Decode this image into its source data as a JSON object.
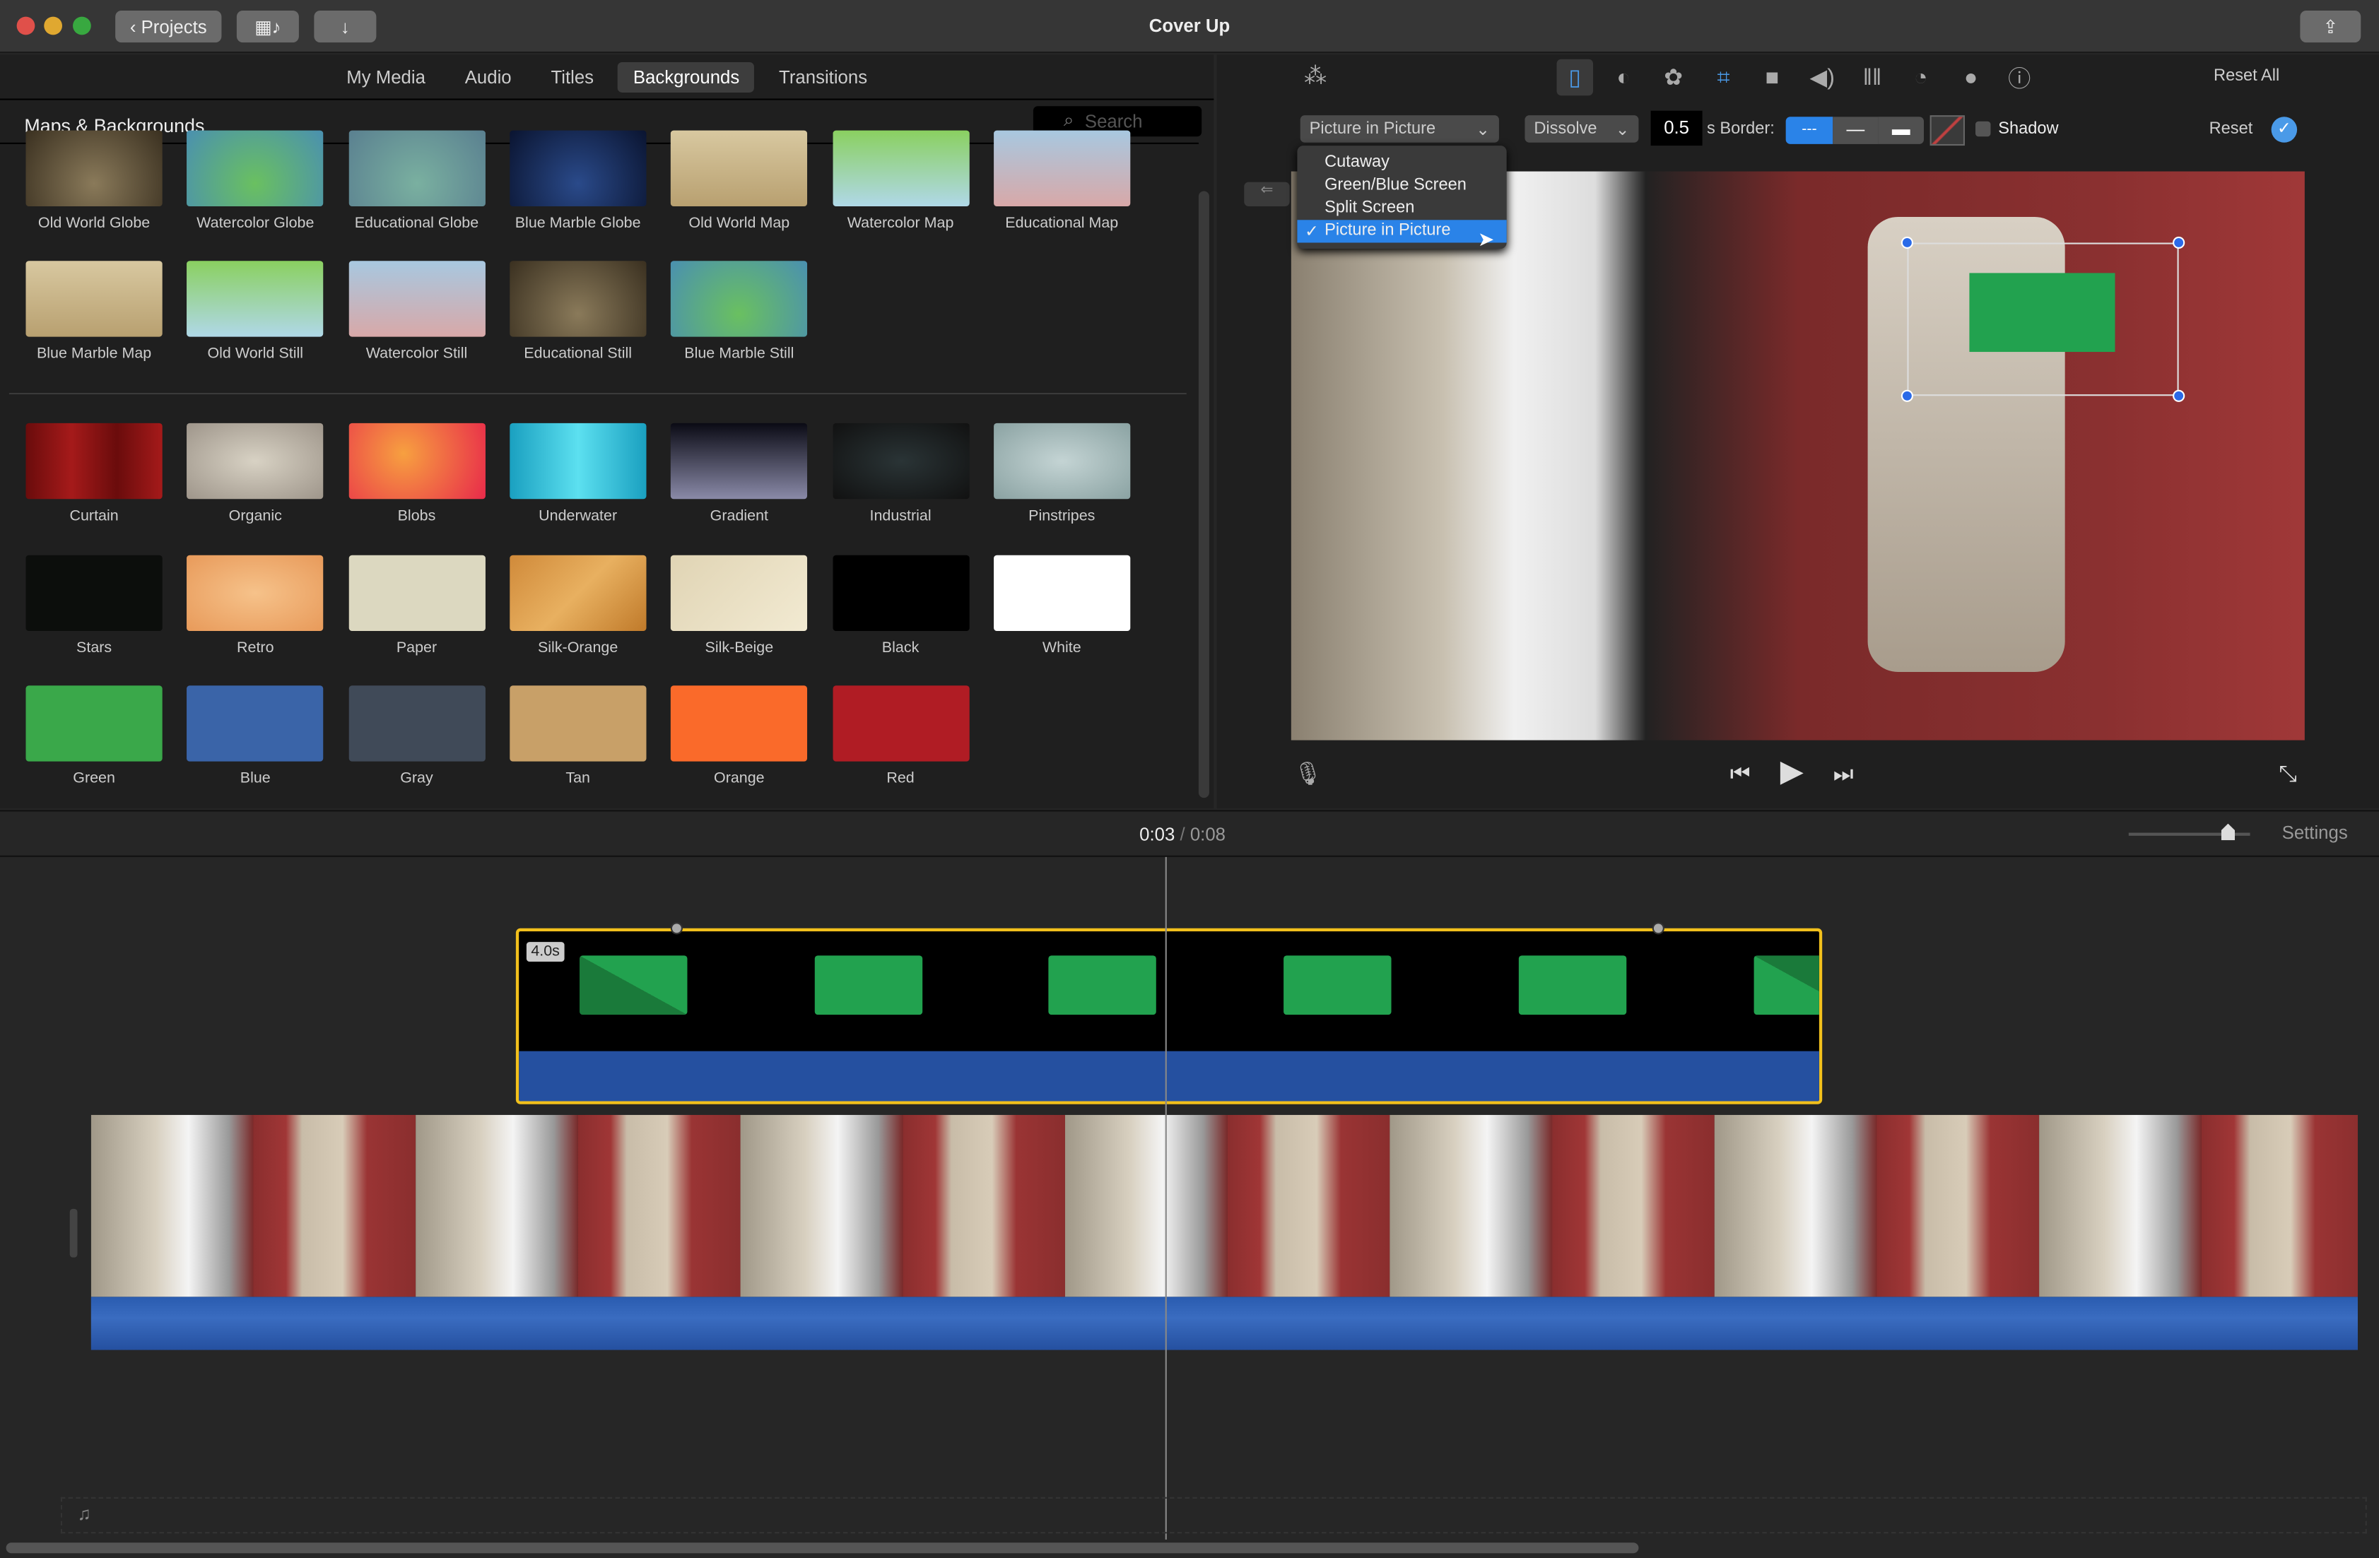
{
  "window": {
    "title": "Cover Up",
    "projects_label": "Projects"
  },
  "colors": {
    "accent": "#2a83e8",
    "clip_border": "#f2c01c",
    "audio_blue": "#2550a0",
    "green": "#22a24f"
  },
  "browser": {
    "tabs": [
      {
        "label": "My Media"
      },
      {
        "label": "Audio"
      },
      {
        "label": "Titles"
      },
      {
        "label": "Backgrounds",
        "selected": true
      },
      {
        "label": "Transitions"
      }
    ],
    "section_title": "Maps & Backgrounds",
    "search_placeholder": "Search",
    "maps": [
      {
        "label": "Old World Globe"
      },
      {
        "label": "Watercolor Globe"
      },
      {
        "label": "Educational Globe"
      },
      {
        "label": "Blue Marble Globe"
      },
      {
        "label": "Old World Map"
      },
      {
        "label": "Watercolor Map"
      },
      {
        "label": "Educational Map"
      },
      {
        "label": "Blue Marble Map"
      },
      {
        "label": "Old World Still"
      },
      {
        "label": "Watercolor Still"
      },
      {
        "label": "Educational Still"
      },
      {
        "label": "Blue Marble Still"
      }
    ],
    "backgrounds": [
      {
        "label": "Curtain",
        "color": "linear-gradient(90deg,#6a0c0c,#a51a1a,#6a0c0c,#a51a1a)"
      },
      {
        "label": "Organic",
        "color": "radial-gradient(#d8d2c4,#9e958a)"
      },
      {
        "label": "Blobs",
        "color": "radial-gradient(circle at 40% 40%,#f7a040,#e82a4a)"
      },
      {
        "label": "Underwater",
        "color": "linear-gradient(90deg,#1aa0c0,#5ce0f0,#1aa0c0)"
      },
      {
        "label": "Gradient",
        "color": "linear-gradient(#0a0a14,#8a8aa8)"
      },
      {
        "label": "Industrial",
        "color": "radial-gradient(#2a3436,#111)"
      },
      {
        "label": "Pinstripes",
        "color": "radial-gradient(#c4d4d4,#8aa2a2)"
      },
      {
        "label": "Stars",
        "color": "#0c0e0c"
      },
      {
        "label": "Retro",
        "color": "radial-gradient(#f6c28a,#e89a5a)"
      },
      {
        "label": "Paper",
        "color": "#dcd8c0"
      },
      {
        "label": "Silk-Orange",
        "color": "linear-gradient(135deg,#d08a3a,#e8b060,#c07a2a)"
      },
      {
        "label": "Silk-Beige",
        "color": "linear-gradient(135deg,#e0d4b4,#f2ead2)"
      },
      {
        "label": "Black",
        "color": "#000"
      },
      {
        "label": "White",
        "color": "#fff"
      },
      {
        "label": "Green",
        "color": "#3aa84a"
      },
      {
        "label": "Blue",
        "color": "#3a64a8"
      },
      {
        "label": "Gray",
        "color": "#404a58"
      },
      {
        "label": "Tan",
        "color": "#c8a068"
      },
      {
        "label": "Orange",
        "color": "#fa6a2a"
      },
      {
        "label": "Red",
        "color": "#b01c24"
      }
    ]
  },
  "viewer": {
    "reset_all": "Reset All",
    "reset": "Reset",
    "overlay_style": "Picture in Picture",
    "overlay_options": [
      {
        "label": "Cutaway"
      },
      {
        "label": "Green/Blue Screen"
      },
      {
        "label": "Split Screen"
      },
      {
        "label": "Picture in Picture",
        "selected": true
      }
    ],
    "transition": "Dissolve",
    "duration": "0.5",
    "duration_unit": "s",
    "border_label": "Border:",
    "shadow_label": "Shadow",
    "shadow_checked": false,
    "tools": [
      "magic-wand",
      "video-overlay",
      "color-balance",
      "color-correction",
      "crop",
      "stabilization",
      "volume",
      "noise-reduction",
      "speed",
      "clip-filter",
      "info"
    ]
  },
  "timeline": {
    "current_time": "0:03",
    "separator": "/",
    "total_time": "0:08",
    "settings_label": "Settings",
    "clip_duration": "4.0s"
  }
}
